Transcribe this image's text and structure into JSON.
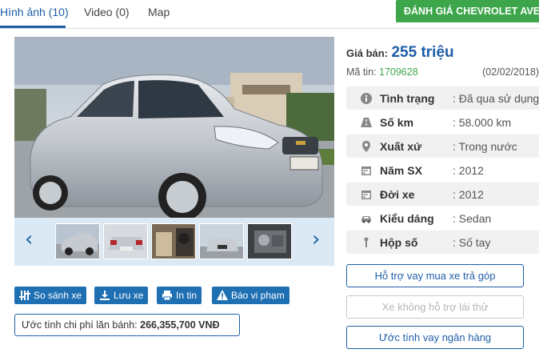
{
  "tabs": [
    {
      "label": "Hình ảnh (10)"
    },
    {
      "label": "Video (0)"
    },
    {
      "label": "Map"
    }
  ],
  "review_button": "ĐÁNH GIÁ CHEVROLET AVEO",
  "gallery": {
    "prev_icon": "chevron-left-icon",
    "next_icon": "chevron-right-icon",
    "thumbnail_count": 5
  },
  "actions": {
    "compare": "So sánh xe",
    "save": "Lưu xe",
    "print": "In tin",
    "report": "Báo vi phạm"
  },
  "estimate": {
    "label": "Ước tính chi phí lăn bánh:",
    "value": "266,355,700 VNĐ"
  },
  "price": {
    "label": "Giá bán:",
    "value": "255 triệu"
  },
  "listing": {
    "code_label": "Mã tin:",
    "code": "1709628",
    "date": "(02/02/2018)"
  },
  "specs": [
    {
      "icon": "info-icon",
      "key": "Tình trạng",
      "value": ": Đã qua sử dụng"
    },
    {
      "icon": "road-icon",
      "key": "Số km",
      "value": ": 58.000 km"
    },
    {
      "icon": "map-pin-icon",
      "key": "Xuất xứ",
      "value": ": Trong nước"
    },
    {
      "icon": "calendar-icon",
      "key": "Năm SX",
      "value": ": 2012"
    },
    {
      "icon": "calendar-icon",
      "key": "Đời xe",
      "value": ": 2012"
    },
    {
      "icon": "car-icon",
      "key": "Kiểu dáng",
      "value": ": Sedan"
    },
    {
      "icon": "gear-shift-icon",
      "key": "Hộp số",
      "value": ": Số tay"
    }
  ],
  "side_buttons": {
    "loan_support": "Hỗ trợ vay mua xe trả góp",
    "test_drive": "Xe không hỗ trợ lái thử",
    "bank_estimate": "Ước tính vay ngân hàng"
  },
  "colors": {
    "accent": "#1f5ea8",
    "green": "#3da64a",
    "button_blue": "#1f6fb3"
  }
}
